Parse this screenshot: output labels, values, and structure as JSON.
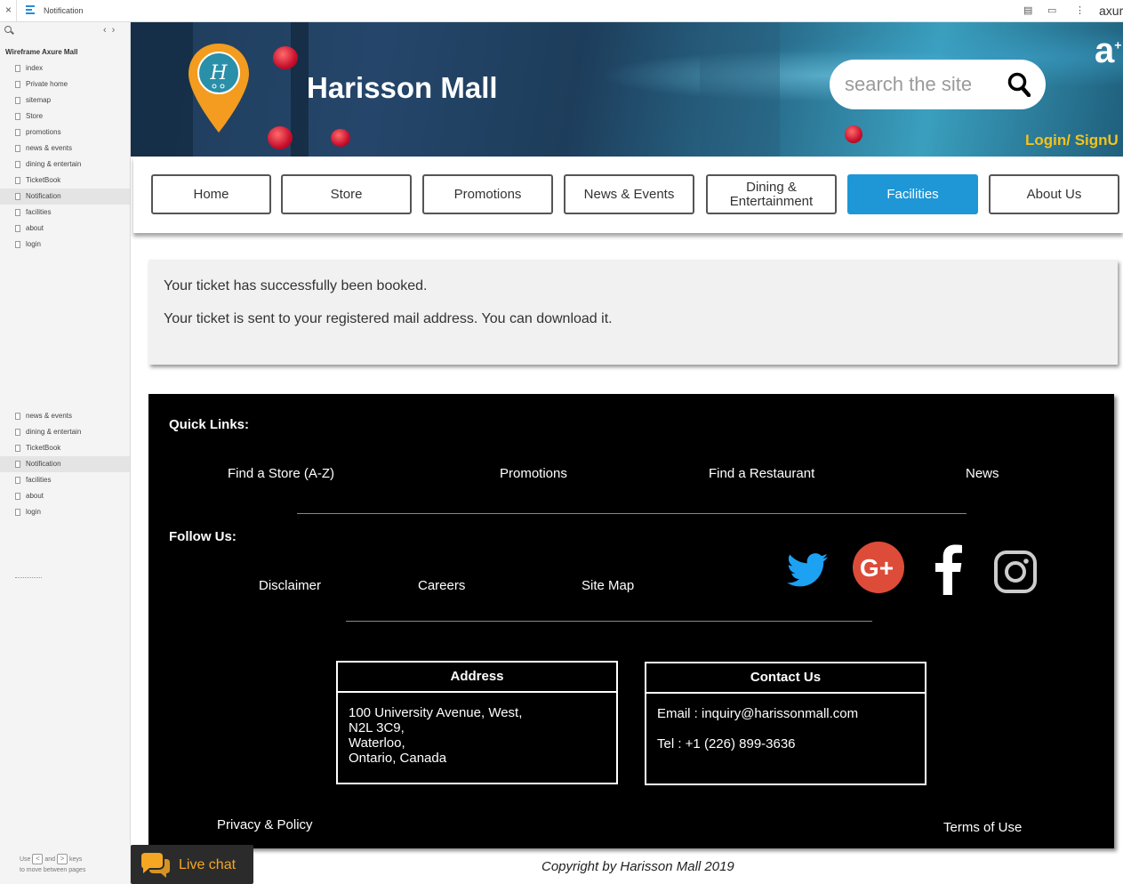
{
  "toolbar": {
    "close": "×",
    "page_title": "Notification",
    "brand": "axur"
  },
  "sidebar": {
    "project": "Wireframe Axure Mall",
    "pages": [
      "index",
      "Private home",
      "sitemap",
      "Store",
      "promotions",
      "news & events",
      "dining & entertain",
      "TicketBook",
      "Notification",
      "facilities",
      "about",
      "login"
    ],
    "pages_lower": [
      "news & events",
      "dining & entertain",
      "TicketBook",
      "Notification",
      "facilities",
      "about",
      "login"
    ],
    "selected": "Notification",
    "hint_use": "Use",
    "hint_and": "and",
    "hint_keys": "keys",
    "hint_tail": "to move between pages"
  },
  "header": {
    "site_title": "Harisson Mall",
    "search_placeholder": "search the site",
    "login": "Login/ SignU"
  },
  "nav": {
    "items": [
      {
        "label": "Home"
      },
      {
        "label": "Store"
      },
      {
        "label": "Promotions"
      },
      {
        "label": "News & Events"
      },
      {
        "label": "Dining & Entertainment"
      },
      {
        "label": "Facilities"
      },
      {
        "label": "About Us"
      }
    ],
    "active": "Facilities"
  },
  "notice": {
    "line1": "Your ticket has successfully been booked.",
    "line2": "Your ticket is sent to your registered mail address. You can download it."
  },
  "footer": {
    "quick_links_label": "Quick Links:",
    "quick_links": [
      "Find a Store (A-Z)",
      "Promotions",
      "Find a Restaurant",
      "News"
    ],
    "follow_label": "Follow Us:",
    "secondary_links": [
      "Disclaimer",
      "Careers",
      "Site Map"
    ],
    "social": [
      "twitter-icon",
      "google-plus-icon",
      "facebook-icon",
      "instagram-icon"
    ],
    "address": {
      "title": "Address",
      "lines": [
        "100 University Avenue, West,",
        "N2L 3C9,",
        "Waterloo,",
        "Ontario, Canada"
      ]
    },
    "contact": {
      "title": "Contact Us",
      "email": "Email : inquiry@harissonmall.com",
      "tel": "Tel : +1 (226) 899-3636"
    },
    "privacy": "Privacy & Policy",
    "terms": "Terms of Use"
  },
  "copyright": "Copyright by Harisson Mall  2019",
  "live_chat": "Live chat",
  "colors": {
    "accent": "#1f97d6",
    "login": "#f4c319",
    "live_chat": "#f5a623",
    "google": "#dd4b39",
    "twitter": "#1da1f2"
  }
}
